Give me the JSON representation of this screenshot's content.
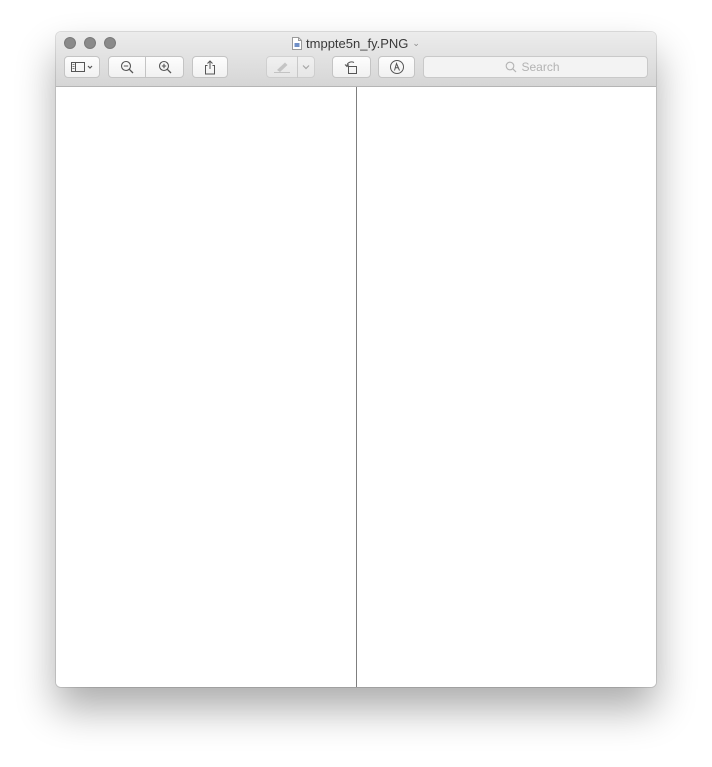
{
  "window": {
    "title": "tmppte5n_fy.PNG",
    "traffic_lights": [
      "close",
      "minimize",
      "zoom"
    ]
  },
  "toolbar": {
    "buttons": [
      {
        "name": "sidebar-button",
        "icon": "sidebar-icon"
      },
      {
        "name": "zoom-out-button",
        "icon": "zoom-out-icon"
      },
      {
        "name": "zoom-in-button",
        "icon": "zoom-in-icon"
      },
      {
        "name": "share-button",
        "icon": "share-icon"
      },
      {
        "name": "highlight-button",
        "icon": "highlighter-icon",
        "enabled": false
      },
      {
        "name": "rotate-button",
        "icon": "rotate-left-icon"
      },
      {
        "name": "markup-button",
        "icon": "markup-pen-icon"
      }
    ],
    "search": {
      "placeholder": "Search",
      "value": ""
    }
  },
  "document": {
    "pages_shown": 2
  }
}
